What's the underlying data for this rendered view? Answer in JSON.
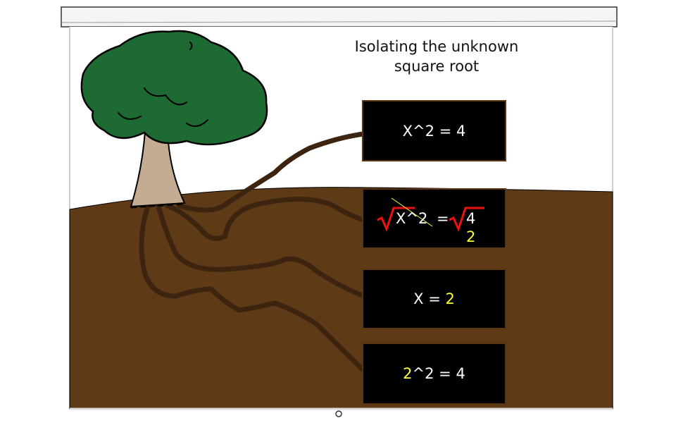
{
  "title": {
    "line1": "Isolating the unknown",
    "line2": "square root"
  },
  "boards": [
    {
      "text": "X^2 = 4"
    },
    {
      "radicand_left": "X^2",
      "equals": "=",
      "radicand_right": "4",
      "result": "2"
    },
    {
      "prefix": "X = ",
      "value": "2"
    },
    {
      "base": "2",
      "suffix": "^2 = 4"
    }
  ],
  "colors": {
    "soil": "#5e3a17",
    "root": "#3d2410",
    "canopy": "#1d6b32",
    "trunk": "#c4ab93",
    "board": "#000000",
    "highlight": "#ffff33",
    "radical": "#ee1111"
  }
}
